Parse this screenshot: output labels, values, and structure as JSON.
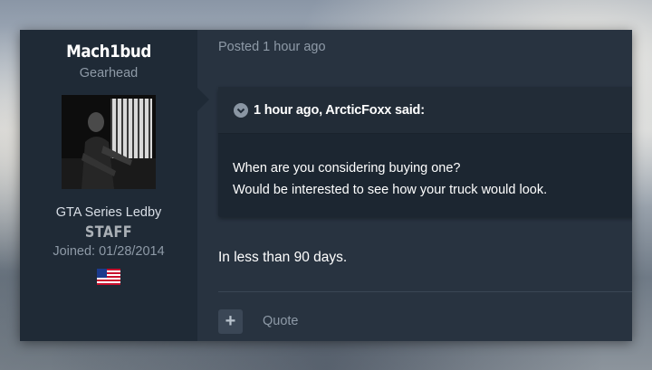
{
  "author": {
    "name": "Mach1bud",
    "title": "Gearhead",
    "group": "GTA Series Ledby",
    "badge": "STAFF",
    "joined": "Joined: 01/28/2014",
    "avatar_icon": "user-avatar-photo",
    "flag_icon": "us-flag-icon"
  },
  "post": {
    "posted": "Posted 1 hour ago",
    "quote": {
      "citation": "1 hour ago, ArcticFoxx said:",
      "toggle_icon": "chevron-down-icon",
      "lines": [
        "When are you considering buying one?",
        "Would be interested to see how your truck would look."
      ]
    },
    "reply": "In less than 90 days."
  },
  "actions": {
    "add_icon": "plus-icon",
    "add_label": "+",
    "quote_label": "Quote"
  }
}
